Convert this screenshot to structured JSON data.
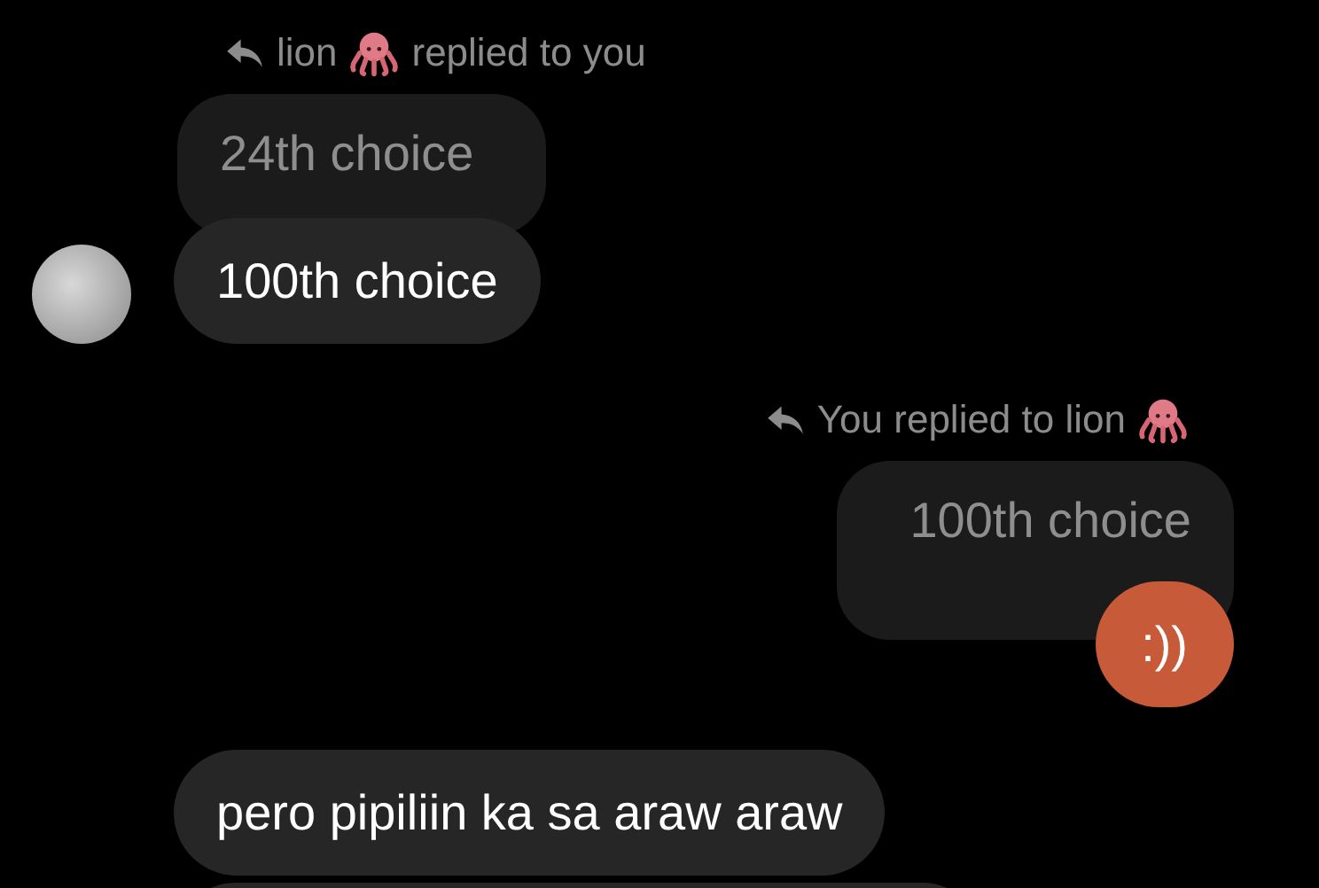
{
  "messages": [
    {
      "kind": "incoming",
      "reply_header": {
        "before_icon": "lion",
        "after_icon": "replied to you"
      },
      "quoted": "24th choice",
      "text": "100th choice",
      "avatar": true
    },
    {
      "kind": "outgoing",
      "reply_header": {
        "before_icon": "You replied to lion"
      },
      "quoted": "100th choice",
      "text": ":))"
    },
    {
      "kind": "incoming",
      "text": "pero pipiliin ka sa araw araw",
      "avatar": false
    },
    {
      "kind": "clipped"
    }
  ]
}
